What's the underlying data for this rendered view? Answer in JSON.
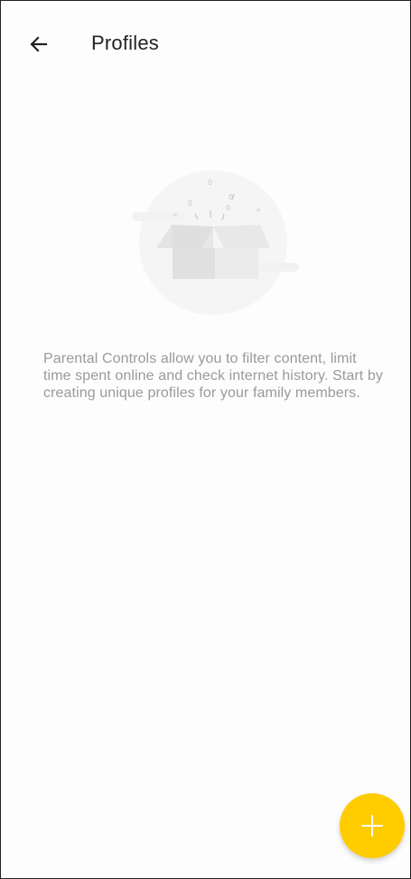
{
  "header": {
    "title": "Profiles",
    "back_icon": "arrow-left-icon"
  },
  "empty_state": {
    "illustration_icon": "open-box-icon",
    "description": "Parental Controls allow you to filter content, limit time spent online and check internet history. Start by creating unique profiles for your family members."
  },
  "fab": {
    "icon": "plus-icon",
    "color": "#FFCC00"
  }
}
